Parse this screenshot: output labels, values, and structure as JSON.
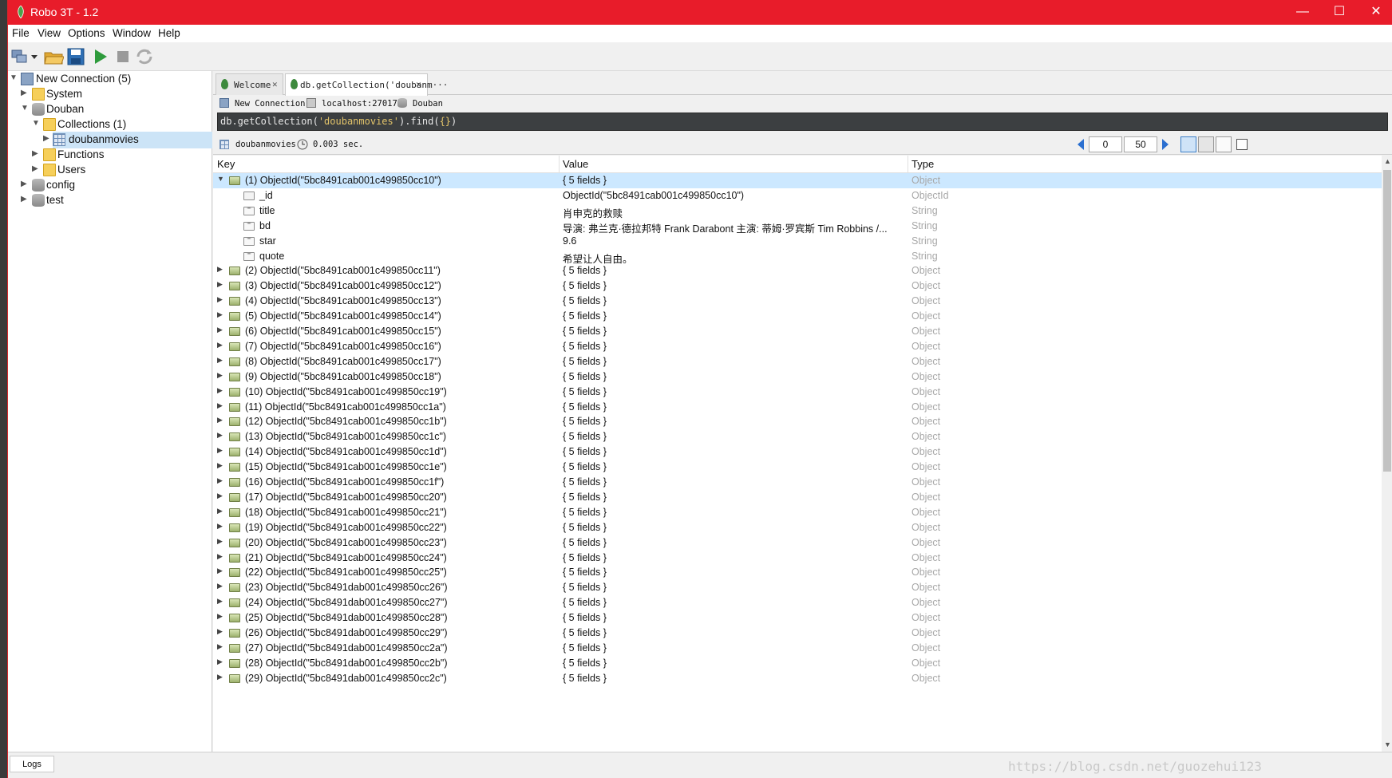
{
  "window": {
    "title": "Robo 3T - 1.2",
    "minimize": "—",
    "maximize": "☐",
    "close": "✕"
  },
  "menu": [
    "File",
    "View",
    "Options",
    "Window",
    "Help"
  ],
  "tree": [
    {
      "label": "New Connection (5)",
      "type": "connection",
      "level": 0,
      "expanded": true
    },
    {
      "label": "System",
      "type": "folder",
      "level": 1,
      "expanded": false
    },
    {
      "label": "Douban",
      "type": "database",
      "level": 1,
      "expanded": true
    },
    {
      "label": "Collections (1)",
      "type": "folder",
      "level": 2,
      "expanded": true
    },
    {
      "label": "doubanmovies",
      "type": "collection",
      "level": 3,
      "expanded": false,
      "selected": true
    },
    {
      "label": "Functions",
      "type": "folder",
      "level": 2,
      "expanded": false
    },
    {
      "label": "Users",
      "type": "folder",
      "level": 2,
      "expanded": false
    },
    {
      "label": "config",
      "type": "database",
      "level": 1,
      "expanded": false
    },
    {
      "label": "test",
      "type": "database",
      "level": 1,
      "expanded": false
    }
  ],
  "tabs": [
    {
      "label": "Welcome",
      "close": "✕"
    },
    {
      "label": "db.getCollection('doubanm···",
      "close": "✕",
      "active": true
    }
  ],
  "crumbs": {
    "connection": "New Connection",
    "host": "localhost:27017",
    "database": "Douban"
  },
  "query": {
    "prefix": "db.getCollection(",
    "collection": "'doubanmovies'",
    "suffix": ").find(",
    "args": "{}",
    "end": ")"
  },
  "result_bar": {
    "collection": "doubanmovies",
    "time": "0.003 sec.",
    "skip": "0",
    "limit": "50"
  },
  "columns": {
    "key": "Key",
    "value": "Value",
    "type": "Type"
  },
  "rows": [
    {
      "key": "(1) ObjectId(\"5bc8491cab001c499850cc10\")",
      "value": "{ 5 fields }",
      "type": "Object",
      "kind": "obj",
      "expanded": true,
      "selected": true,
      "level": 0
    },
    {
      "key": "_id",
      "value": "ObjectId(\"5bc8491cab001c499850cc10\")",
      "type": "ObjectId",
      "kind": "oid",
      "level": 1
    },
    {
      "key": "title",
      "value": "肖申克的救赎",
      "type": "String",
      "kind": "str",
      "level": 1
    },
    {
      "key": "bd",
      "value": "导演: 弗兰克·德拉邦特 Frank Darabont   主演: 蒂姆·罗宾斯 Tim Robbins /...",
      "type": "String",
      "kind": "str",
      "level": 1
    },
    {
      "key": "star",
      "value": "9.6",
      "type": "String",
      "kind": "str",
      "level": 1
    },
    {
      "key": "quote",
      "value": "希望让人自由。",
      "type": "String",
      "kind": "str",
      "level": 1
    },
    {
      "key": "(2) ObjectId(\"5bc8491cab001c499850cc11\")",
      "value": "{ 5 fields }",
      "type": "Object",
      "kind": "obj",
      "level": 0
    },
    {
      "key": "(3) ObjectId(\"5bc8491cab001c499850cc12\")",
      "value": "{ 5 fields }",
      "type": "Object",
      "kind": "obj",
      "level": 0
    },
    {
      "key": "(4) ObjectId(\"5bc8491cab001c499850cc13\")",
      "value": "{ 5 fields }",
      "type": "Object",
      "kind": "obj",
      "level": 0
    },
    {
      "key": "(5) ObjectId(\"5bc8491cab001c499850cc14\")",
      "value": "{ 5 fields }",
      "type": "Object",
      "kind": "obj",
      "level": 0
    },
    {
      "key": "(6) ObjectId(\"5bc8491cab001c499850cc15\")",
      "value": "{ 5 fields }",
      "type": "Object",
      "kind": "obj",
      "level": 0
    },
    {
      "key": "(7) ObjectId(\"5bc8491cab001c499850cc16\")",
      "value": "{ 5 fields }",
      "type": "Object",
      "kind": "obj",
      "level": 0
    },
    {
      "key": "(8) ObjectId(\"5bc8491cab001c499850cc17\")",
      "value": "{ 5 fields }",
      "type": "Object",
      "kind": "obj",
      "level": 0
    },
    {
      "key": "(9) ObjectId(\"5bc8491cab001c499850cc18\")",
      "value": "{ 5 fields }",
      "type": "Object",
      "kind": "obj",
      "level": 0
    },
    {
      "key": "(10) ObjectId(\"5bc8491cab001c499850cc19\")",
      "value": "{ 5 fields }",
      "type": "Object",
      "kind": "obj",
      "level": 0
    },
    {
      "key": "(11) ObjectId(\"5bc8491cab001c499850cc1a\")",
      "value": "{ 5 fields }",
      "type": "Object",
      "kind": "obj",
      "level": 0
    },
    {
      "key": "(12) ObjectId(\"5bc8491cab001c499850cc1b\")",
      "value": "{ 5 fields }",
      "type": "Object",
      "kind": "obj",
      "level": 0
    },
    {
      "key": "(13) ObjectId(\"5bc8491cab001c499850cc1c\")",
      "value": "{ 5 fields }",
      "type": "Object",
      "kind": "obj",
      "level": 0
    },
    {
      "key": "(14) ObjectId(\"5bc8491cab001c499850cc1d\")",
      "value": "{ 5 fields }",
      "type": "Object",
      "kind": "obj",
      "level": 0
    },
    {
      "key": "(15) ObjectId(\"5bc8491cab001c499850cc1e\")",
      "value": "{ 5 fields }",
      "type": "Object",
      "kind": "obj",
      "level": 0
    },
    {
      "key": "(16) ObjectId(\"5bc8491cab001c499850cc1f\")",
      "value": "{ 5 fields }",
      "type": "Object",
      "kind": "obj",
      "level": 0
    },
    {
      "key": "(17) ObjectId(\"5bc8491cab001c499850cc20\")",
      "value": "{ 5 fields }",
      "type": "Object",
      "kind": "obj",
      "level": 0
    },
    {
      "key": "(18) ObjectId(\"5bc8491cab001c499850cc21\")",
      "value": "{ 5 fields }",
      "type": "Object",
      "kind": "obj",
      "level": 0
    },
    {
      "key": "(19) ObjectId(\"5bc8491cab001c499850cc22\")",
      "value": "{ 5 fields }",
      "type": "Object",
      "kind": "obj",
      "level": 0
    },
    {
      "key": "(20) ObjectId(\"5bc8491cab001c499850cc23\")",
      "value": "{ 5 fields }",
      "type": "Object",
      "kind": "obj",
      "level": 0
    },
    {
      "key": "(21) ObjectId(\"5bc8491cab001c499850cc24\")",
      "value": "{ 5 fields }",
      "type": "Object",
      "kind": "obj",
      "level": 0
    },
    {
      "key": "(22) ObjectId(\"5bc8491cab001c499850cc25\")",
      "value": "{ 5 fields }",
      "type": "Object",
      "kind": "obj",
      "level": 0
    },
    {
      "key": "(23) ObjectId(\"5bc8491dab001c499850cc26\")",
      "value": "{ 5 fields }",
      "type": "Object",
      "kind": "obj",
      "level": 0
    },
    {
      "key": "(24) ObjectId(\"5bc8491dab001c499850cc27\")",
      "value": "{ 5 fields }",
      "type": "Object",
      "kind": "obj",
      "level": 0
    },
    {
      "key": "(25) ObjectId(\"5bc8491dab001c499850cc28\")",
      "value": "{ 5 fields }",
      "type": "Object",
      "kind": "obj",
      "level": 0
    },
    {
      "key": "(26) ObjectId(\"5bc8491dab001c499850cc29\")",
      "value": "{ 5 fields }",
      "type": "Object",
      "kind": "obj",
      "level": 0
    },
    {
      "key": "(27) ObjectId(\"5bc8491dab001c499850cc2a\")",
      "value": "{ 5 fields }",
      "type": "Object",
      "kind": "obj",
      "level": 0
    },
    {
      "key": "(28) ObjectId(\"5bc8491dab001c499850cc2b\")",
      "value": "{ 5 fields }",
      "type": "Object",
      "kind": "obj",
      "level": 0
    },
    {
      "key": "(29) ObjectId(\"5bc8491dab001c499850cc2c\")",
      "value": "{ 5 fields }",
      "type": "Object",
      "kind": "obj",
      "level": 0
    }
  ],
  "status": {
    "logs": "Logs",
    "watermark": "https://blog.csdn.net/guozehui123"
  },
  "colors": {
    "titlebar": "#e81c2a",
    "selection": "#cce8ff",
    "type_text": "#a8a8a8",
    "query_bg": "#3c3f41"
  }
}
